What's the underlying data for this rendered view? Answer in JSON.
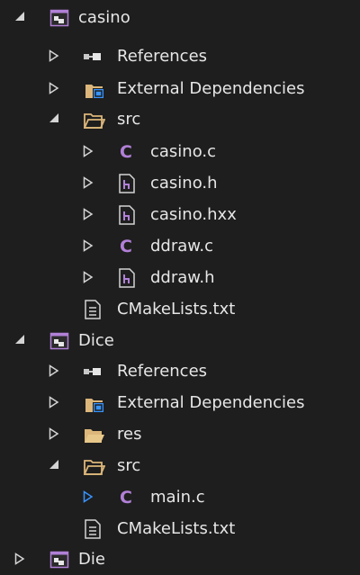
{
  "colors": {
    "background": "#1e1e1e",
    "text": "#e6e6e6",
    "arrow": "#d4d4d4",
    "arrow_selected": "#3794ff",
    "c_file": "#b180d7",
    "folder": "#dcb67a"
  },
  "tree": {
    "casino": {
      "label": "casino",
      "references": "References",
      "external": "External Dependencies",
      "src": {
        "label": "src",
        "files": [
          "casino.c",
          "casino.h",
          "casino.hxx",
          "ddraw.c",
          "ddraw.h"
        ]
      },
      "cmake": "CMakeLists.txt"
    },
    "dice": {
      "label": "Dice",
      "references": "References",
      "external": "External Dependencies",
      "res": "res",
      "src": {
        "label": "src",
        "files": [
          "main.c"
        ]
      },
      "cmake": "CMakeLists.txt"
    },
    "die": {
      "label": "Die"
    }
  },
  "icons": {
    "project": "project-icon",
    "references": "references-icon",
    "external": "external-dependencies-icon",
    "filter_folder": "filter-folder-icon",
    "c_file": "c-source-file-icon",
    "header_file": "header-file-icon",
    "text_file": "text-file-icon",
    "expanded": "expanded-triangle-icon",
    "collapsed": "collapsed-triangle-icon"
  },
  "c_glyph": "C"
}
